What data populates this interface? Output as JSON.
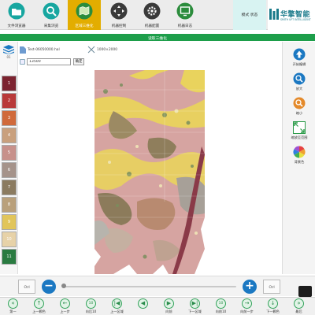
{
  "toolbar": {
    "buttons": [
      {
        "label": "文件浏览器",
        "icon": "folder-icon"
      },
      {
        "label": "采集浏览",
        "icon": "search-icon"
      },
      {
        "label": "区域三维化",
        "icon": "map-icon",
        "active": true
      },
      {
        "label": "机器控制",
        "icon": "direction-pad-icon"
      },
      {
        "label": "机器配置",
        "icon": "gear-icon"
      },
      {
        "label": "机器日志",
        "icon": "monitor-icon"
      }
    ],
    "mode_label": "模式 状态",
    "brand_name": "华擎智能",
    "brand_sub": "SMITH UFT INTELLIGENT"
  },
  "title_bar": {
    "text": "读取三维化"
  },
  "left_panel": {
    "top_label": "01",
    "layers": [
      {
        "label": "1",
        "color": "#7c2330"
      },
      {
        "label": "2",
        "color": "#b93a3a"
      },
      {
        "label": "3",
        "color": "#d06a3b"
      },
      {
        "label": "4",
        "color": "#c9a07d"
      },
      {
        "label": "5",
        "color": "#c7918b"
      },
      {
        "label": "6",
        "color": "#a5938a"
      },
      {
        "label": "7",
        "color": "#8b7b60"
      },
      {
        "label": "8",
        "color": "#b9a07b"
      },
      {
        "label": "9",
        "color": "#e1c55b"
      },
      {
        "label": "10",
        "color": "#e7d2a8"
      },
      {
        "label": "11",
        "color": "#2a7b41"
      }
    ]
  },
  "file_info": {
    "file_name": "Test-06050000.hal",
    "size": "1000×2000"
  },
  "scale": {
    "value": "13500",
    "confirm_label": "确定"
  },
  "right_panel": {
    "buttons": [
      {
        "label": "开始编辑",
        "icon": "arrow-up-icon",
        "color": "#1b78c2"
      },
      {
        "label": "放大",
        "icon": "zoom-in-icon",
        "color": "#1b78c2"
      },
      {
        "label": "缩小",
        "icon": "zoom-out-icon",
        "color": "#e48a2b"
      },
      {
        "label": "缩放至范围",
        "icon": "fit-extent-icon",
        "color": "#2a9b48"
      },
      {
        "label": "背景色",
        "icon": "color-wheel-icon",
        "color": "#e46fa0"
      }
    ]
  },
  "zoom": {
    "left_box": "Ctrl",
    "right_box": "Ctrl",
    "minus_label": "−",
    "plus_label": "+",
    "level": 0.0
  },
  "bottom_nav": {
    "buttons": [
      {
        "label": "第一",
        "icon": "«"
      },
      {
        "label": "上一颗色",
        "icon": "↑"
      },
      {
        "label": "上一步",
        "icon": "←"
      },
      {
        "label": "向后10",
        "icon": "10"
      },
      {
        "label": "上一区域",
        "icon": "|◀"
      },
      {
        "label": "",
        "icon": "◀"
      },
      {
        "label": "向前",
        "icon": "▶"
      },
      {
        "label": "下一区域",
        "icon": "▶|"
      },
      {
        "label": "向前10",
        "icon": "10"
      },
      {
        "label": "向前一步",
        "icon": "→"
      },
      {
        "label": "下一颗色",
        "icon": "↓"
      },
      {
        "label": "最后",
        "icon": "»"
      }
    ]
  }
}
